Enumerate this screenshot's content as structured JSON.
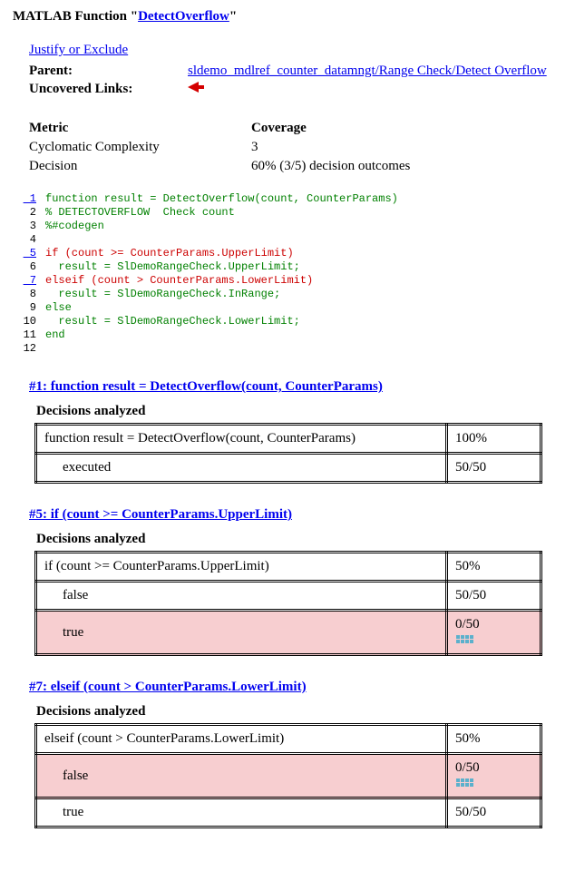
{
  "title": {
    "prefix": "MATLAB Function \"",
    "link_text": "DetectOverflow",
    "suffix": "\""
  },
  "top_links": {
    "justify": "Justify or Exclude",
    "parent_label": "Parent:",
    "parent_link": "sldemo_mdlref_counter_datamngt/Range Check/Detect Overflow",
    "uncovered_label": "Uncovered Links:"
  },
  "metrics": {
    "head_metric": "Metric",
    "head_cov": "Coverage",
    "rows": [
      {
        "metric": "Cyclomatic Complexity",
        "cov": "3"
      },
      {
        "metric": "Decision",
        "cov": "60% (3/5) decision outcomes"
      }
    ]
  },
  "code": [
    {
      "n": "1",
      "ln_link": true,
      "color": "green",
      "text": "function result = DetectOverflow(count, CounterParams)"
    },
    {
      "n": "2",
      "ln_link": false,
      "color": "green",
      "text": "% DETECTOVERFLOW  Check count"
    },
    {
      "n": "3",
      "ln_link": false,
      "color": "green",
      "text": "%#codegen"
    },
    {
      "n": "4",
      "ln_link": false,
      "color": "",
      "text": ""
    },
    {
      "n": "5",
      "ln_link": true,
      "color": "red",
      "text": "if (count >= CounterParams.UpperLimit)"
    },
    {
      "n": "6",
      "ln_link": false,
      "color": "green",
      "text": "  result = SlDemoRangeCheck.UpperLimit;"
    },
    {
      "n": "7",
      "ln_link": true,
      "color": "red",
      "text": "elseif (count > CounterParams.LowerLimit)"
    },
    {
      "n": "8",
      "ln_link": false,
      "color": "green",
      "text": "  result = SlDemoRangeCheck.InRange;"
    },
    {
      "n": "9",
      "ln_link": false,
      "color": "green",
      "text": "else"
    },
    {
      "n": "10",
      "ln_link": false,
      "color": "green",
      "text": "  result = SlDemoRangeCheck.LowerLimit;"
    },
    {
      "n": "11",
      "ln_link": false,
      "color": "green",
      "text": "end"
    },
    {
      "n": "12",
      "ln_link": false,
      "color": "",
      "text": ""
    }
  ],
  "detail1": {
    "link": "#1: function result = DetectOverflow(count, CounterParams)",
    "header": "Decisions analyzed",
    "expr": "function result = DetectOverflow(count, CounterParams)",
    "pct": "100%",
    "rows": [
      {
        "label": "executed",
        "val": "50/50",
        "uncov": false
      }
    ]
  },
  "detail5": {
    "link": "#5: if (count >= CounterParams.UpperLimit)",
    "header": "Decisions analyzed",
    "expr": "if (count >= CounterParams.UpperLimit)",
    "pct": "50%",
    "rows": [
      {
        "label": "false",
        "val": "50/50",
        "uncov": false
      },
      {
        "label": "true",
        "val": "0/50",
        "uncov": true
      }
    ]
  },
  "detail7": {
    "link": "#7: elseif (count > CounterParams.LowerLimit)",
    "header": "Decisions analyzed",
    "expr": "elseif (count > CounterParams.LowerLimit)",
    "pct": "50%",
    "rows": [
      {
        "label": "false",
        "val": "0/50",
        "uncov": true
      },
      {
        "label": "true",
        "val": "50/50",
        "uncov": false
      }
    ]
  }
}
